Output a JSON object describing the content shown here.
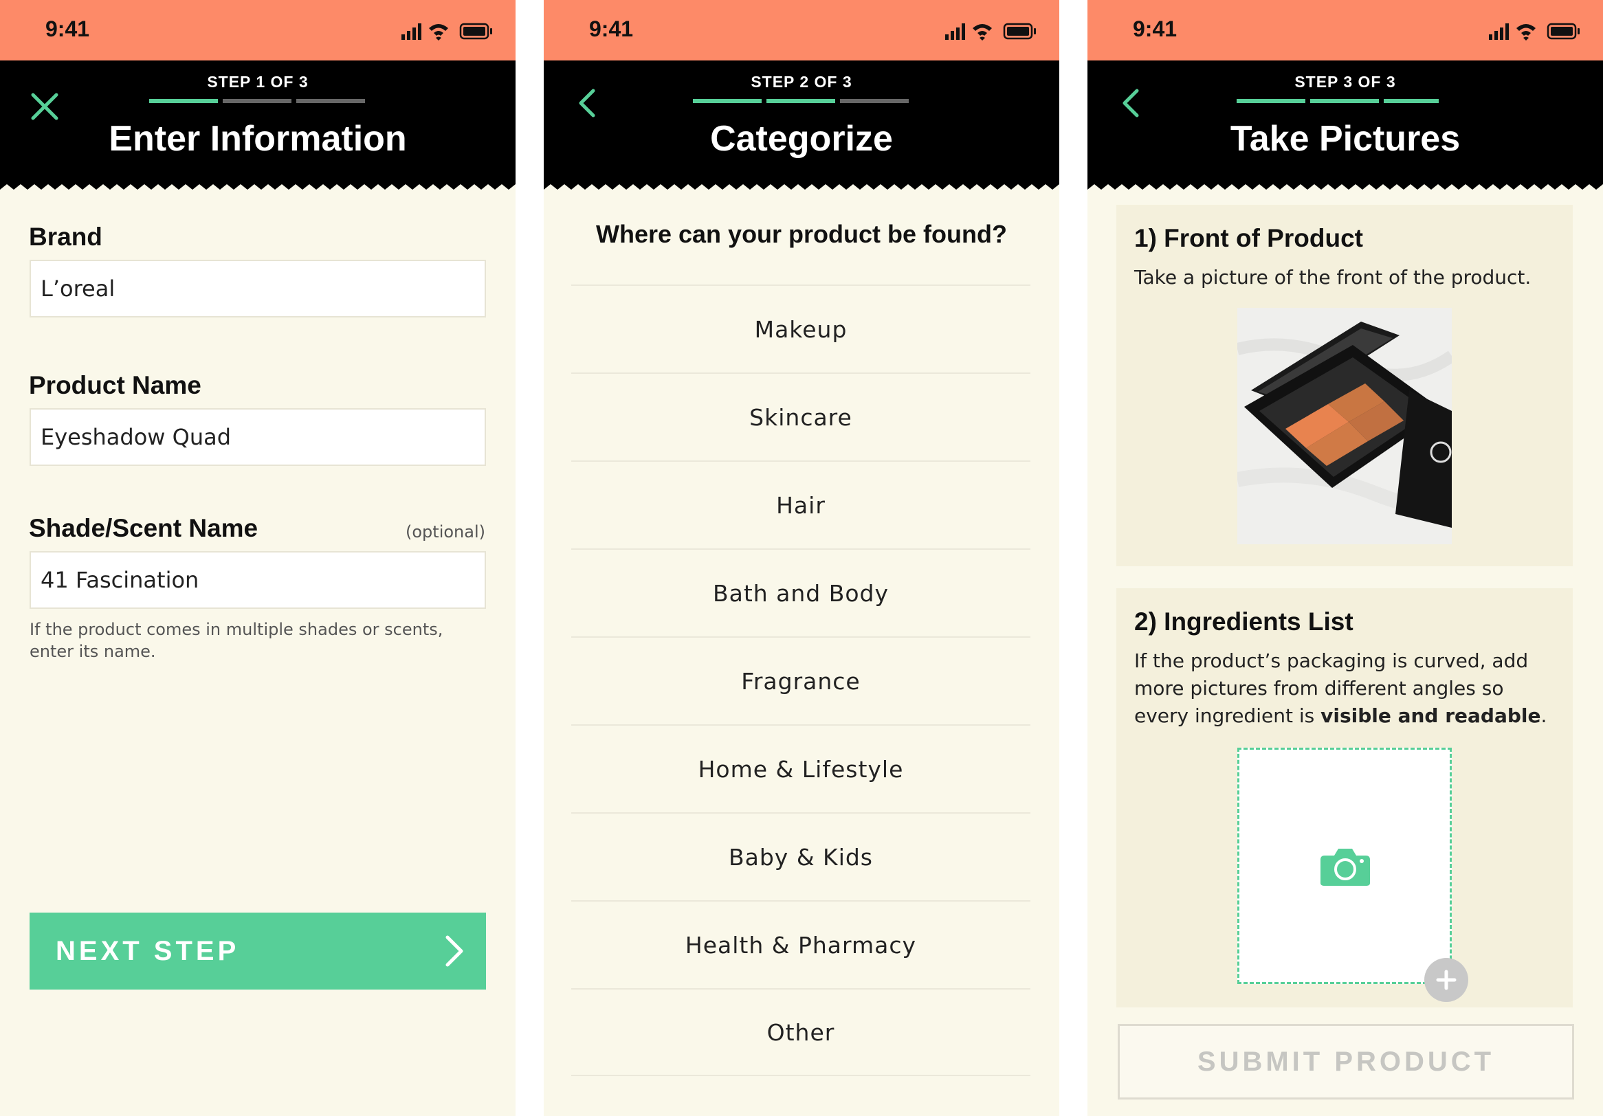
{
  "status": {
    "time": "9:41"
  },
  "colors": {
    "accent": "#57cf98",
    "statusbar": "#fd8a68",
    "header": "#000000",
    "background": "#faf8ea"
  },
  "screen1": {
    "step": "STEP 1 OF 3",
    "title": "Enter Information",
    "progress_filled": 1,
    "brand": {
      "label": "Brand",
      "value": "L’oreal"
    },
    "product": {
      "label": "Product Name",
      "value": "Eyeshadow Quad"
    },
    "shade": {
      "label": "Shade/Scent Name",
      "optional": "(optional)",
      "value": "41 Fascination"
    },
    "hint": "If the product comes in multiple shades or scents, enter its name.",
    "next_button": "NEXT STEP"
  },
  "screen2": {
    "step": "STEP 2 OF 3",
    "title": "Categorize",
    "progress_filled": 2,
    "question": "Where can your product be found?",
    "categories": [
      "Makeup",
      "Skincare",
      "Hair",
      "Bath and Body",
      "Fragrance",
      "Home & Lifestyle",
      "Baby & Kids",
      "Health & Pharmacy",
      "Other"
    ]
  },
  "screen3": {
    "step": "STEP 3 OF 3",
    "title": "Take Pictures",
    "progress_filled": 3,
    "front": {
      "title": "1) Front of Product",
      "desc": "Take a picture of the front of the product."
    },
    "ingredients": {
      "title": "2) Ingredients List",
      "desc_before": "If the product’s packaging is curved, add more pictures from different angles so every ingredient is ",
      "desc_bold": "visible and readable",
      "desc_after": "."
    },
    "submit_button": "SUBMIT PRODUCT"
  }
}
